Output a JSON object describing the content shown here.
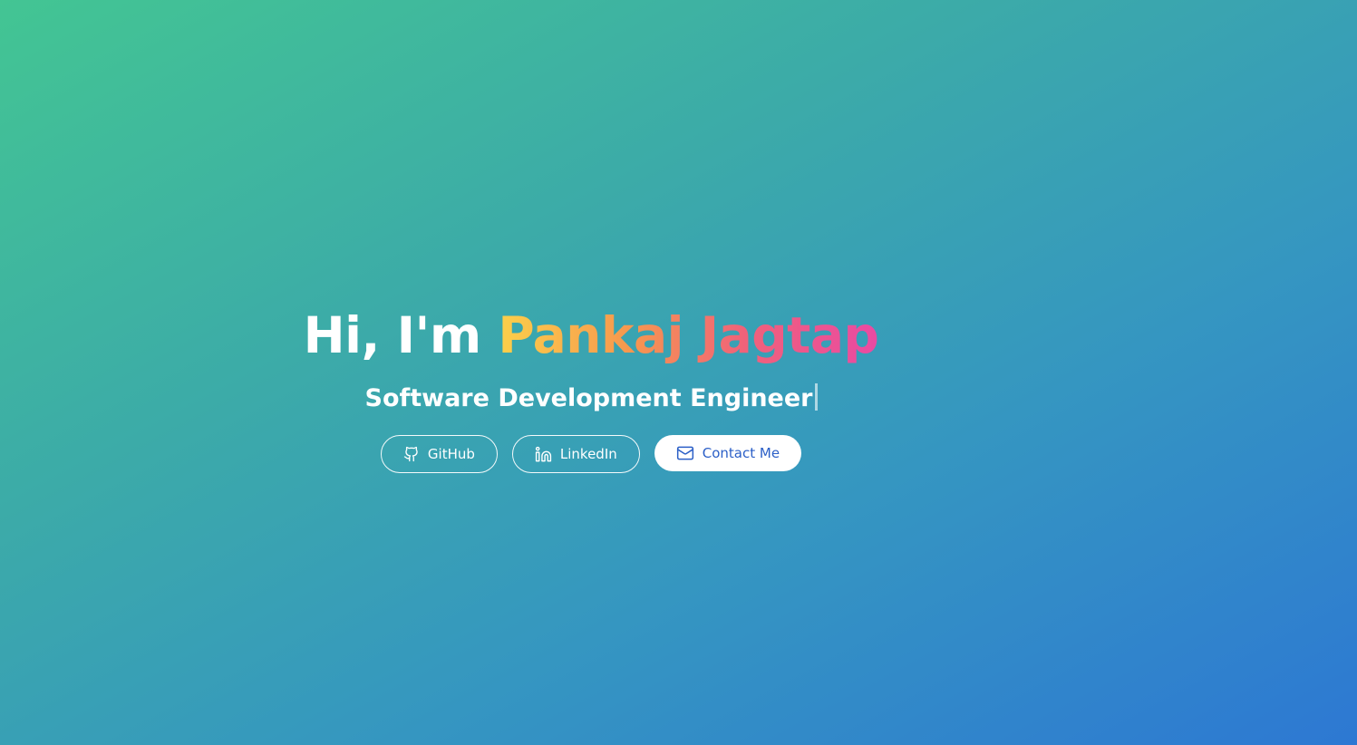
{
  "hero": {
    "greeting": "Hi, I'm",
    "name": "Pankaj Jagtap",
    "subtitle": "Software Development Engineer"
  },
  "buttons": {
    "github": {
      "label": "GitHub",
      "icon": "github-icon"
    },
    "linkedin": {
      "label": "LinkedIn",
      "icon": "linkedin-icon"
    },
    "contact": {
      "label": "Contact Me",
      "icon": "mail-icon"
    }
  },
  "colors": {
    "background_start": "#43c593",
    "background_end": "#2d78d3",
    "name_gradient": [
      "#fcd04a",
      "#f6974f",
      "#f0627a",
      "#e94aa3"
    ],
    "contact_text": "#2b5fc7"
  }
}
